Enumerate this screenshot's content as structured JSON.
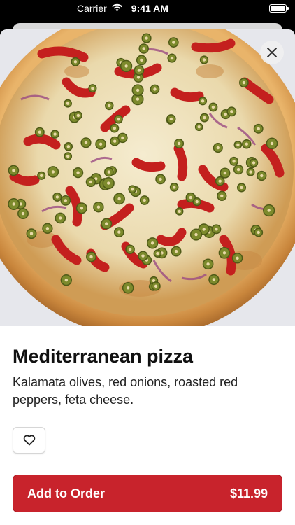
{
  "status_bar": {
    "carrier": "Carrier",
    "time": "9:41 AM",
    "wifi_icon": "wifi-icon",
    "battery_icon": "battery-icon"
  },
  "product": {
    "image_icon": "pizza-photo",
    "name": "Mediterranean pizza",
    "description": "Kalamata olives, red onions, roasted red peppers, feta cheese.",
    "price": "$11.99"
  },
  "actions": {
    "close_icon": "close-icon",
    "favorite_icon": "heart-icon",
    "add_to_order_label": "Add to Order"
  },
  "colors": {
    "accent": "#c8232c",
    "text": "#111111"
  }
}
